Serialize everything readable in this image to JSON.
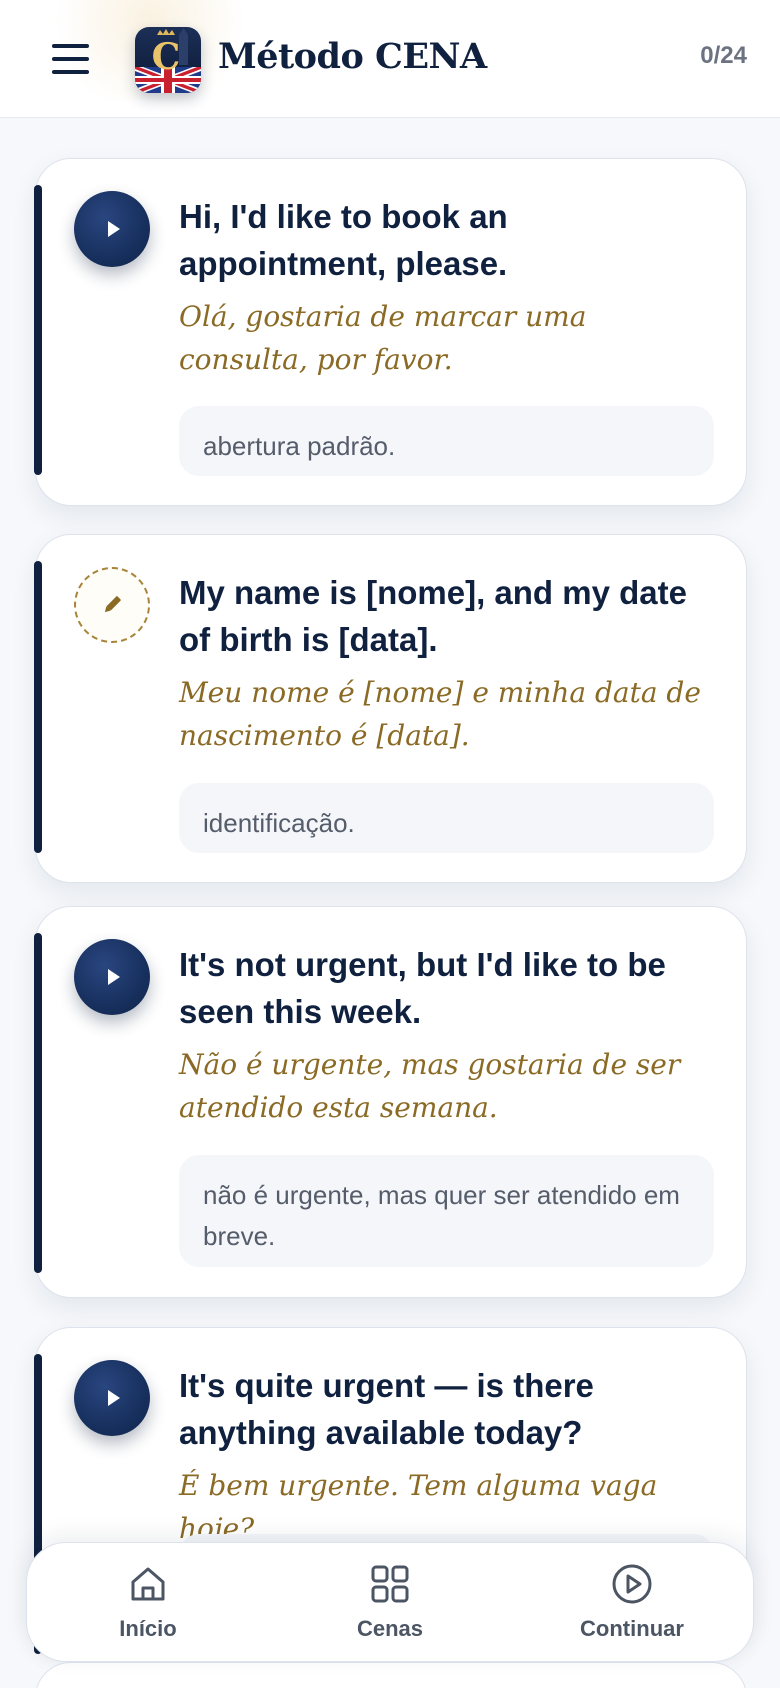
{
  "header": {
    "title": "Método CENA",
    "progress": "0/24",
    "logo_letter": "C"
  },
  "phrases": [
    {
      "english": "Hi, I'd like to book an appointment, please.",
      "portuguese": "Olá, gostaria de marcar uma consulta, por favor.",
      "note": "abertura padrão.",
      "action": "play"
    },
    {
      "english": "My name is [nome], and my date of birth is [data].",
      "portuguese": "Meu nome é [nome] e minha data de nascimento é [data].",
      "note": "identificação.",
      "action": "edit"
    },
    {
      "english": "It's not urgent, but I'd like to be seen this week.",
      "portuguese": "Não é urgente, mas gostaria de ser atendido esta semana.",
      "note": "não é urgente, mas quer ser atendido em breve.",
      "action": "play"
    },
    {
      "english": "It's quite urgent — is there anything available today?",
      "portuguese": "É bem urgente. Tem alguma vaga hoje?",
      "action": "play"
    }
  ],
  "bottom_nav": [
    {
      "label": "Início",
      "icon": "home-icon"
    },
    {
      "label": "Cenas",
      "icon": "grid-icon"
    },
    {
      "label": "Continuar",
      "icon": "play-circle-icon"
    }
  ],
  "colors": {
    "navy": "#10213f",
    "gold": "#8a6a24",
    "background": "#f6f8fb"
  }
}
